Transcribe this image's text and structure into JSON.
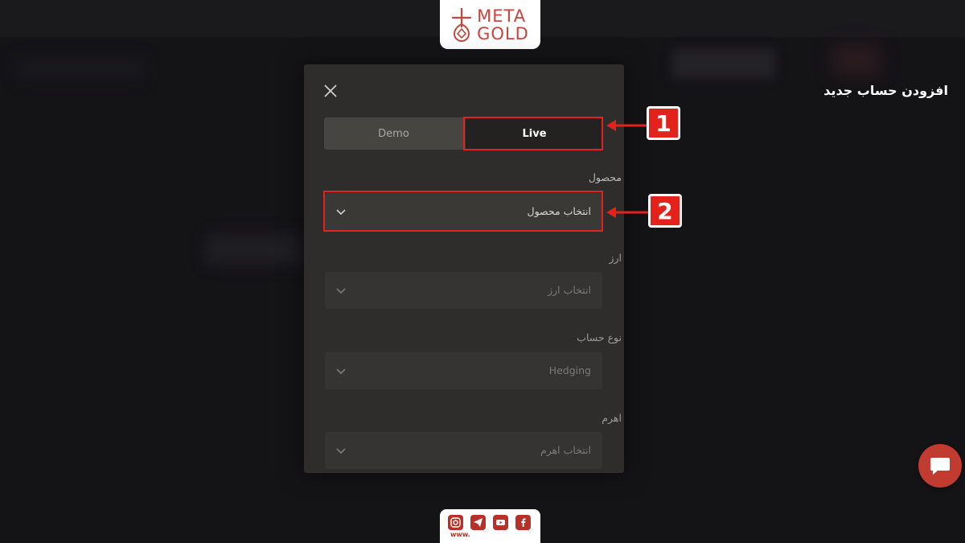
{
  "logo": {
    "line1": "META",
    "line2": "GOLD"
  },
  "dialog": {
    "title": "افزودن حساب جدید",
    "tabs": [
      {
        "label": "Demo",
        "selected": false
      },
      {
        "label": "Live",
        "selected": true
      }
    ],
    "fields": [
      {
        "label": "محصول",
        "value": "انتخاب محصول",
        "enabled": true
      },
      {
        "label": "ارز",
        "value": "انتخاب ارز",
        "enabled": false
      },
      {
        "label": "نوع حساب",
        "value": "Hedging",
        "enabled": false
      },
      {
        "label": "اهرم",
        "value": "انتخاب اهرم",
        "enabled": false
      }
    ]
  },
  "annotations": [
    {
      "number": "1"
    },
    {
      "number": "2"
    }
  ],
  "social": {
    "url_text": "www."
  },
  "colors": {
    "accent": "#e3221c",
    "brand": "#c9453b",
    "dialog_bg": "#2e2d2b"
  }
}
